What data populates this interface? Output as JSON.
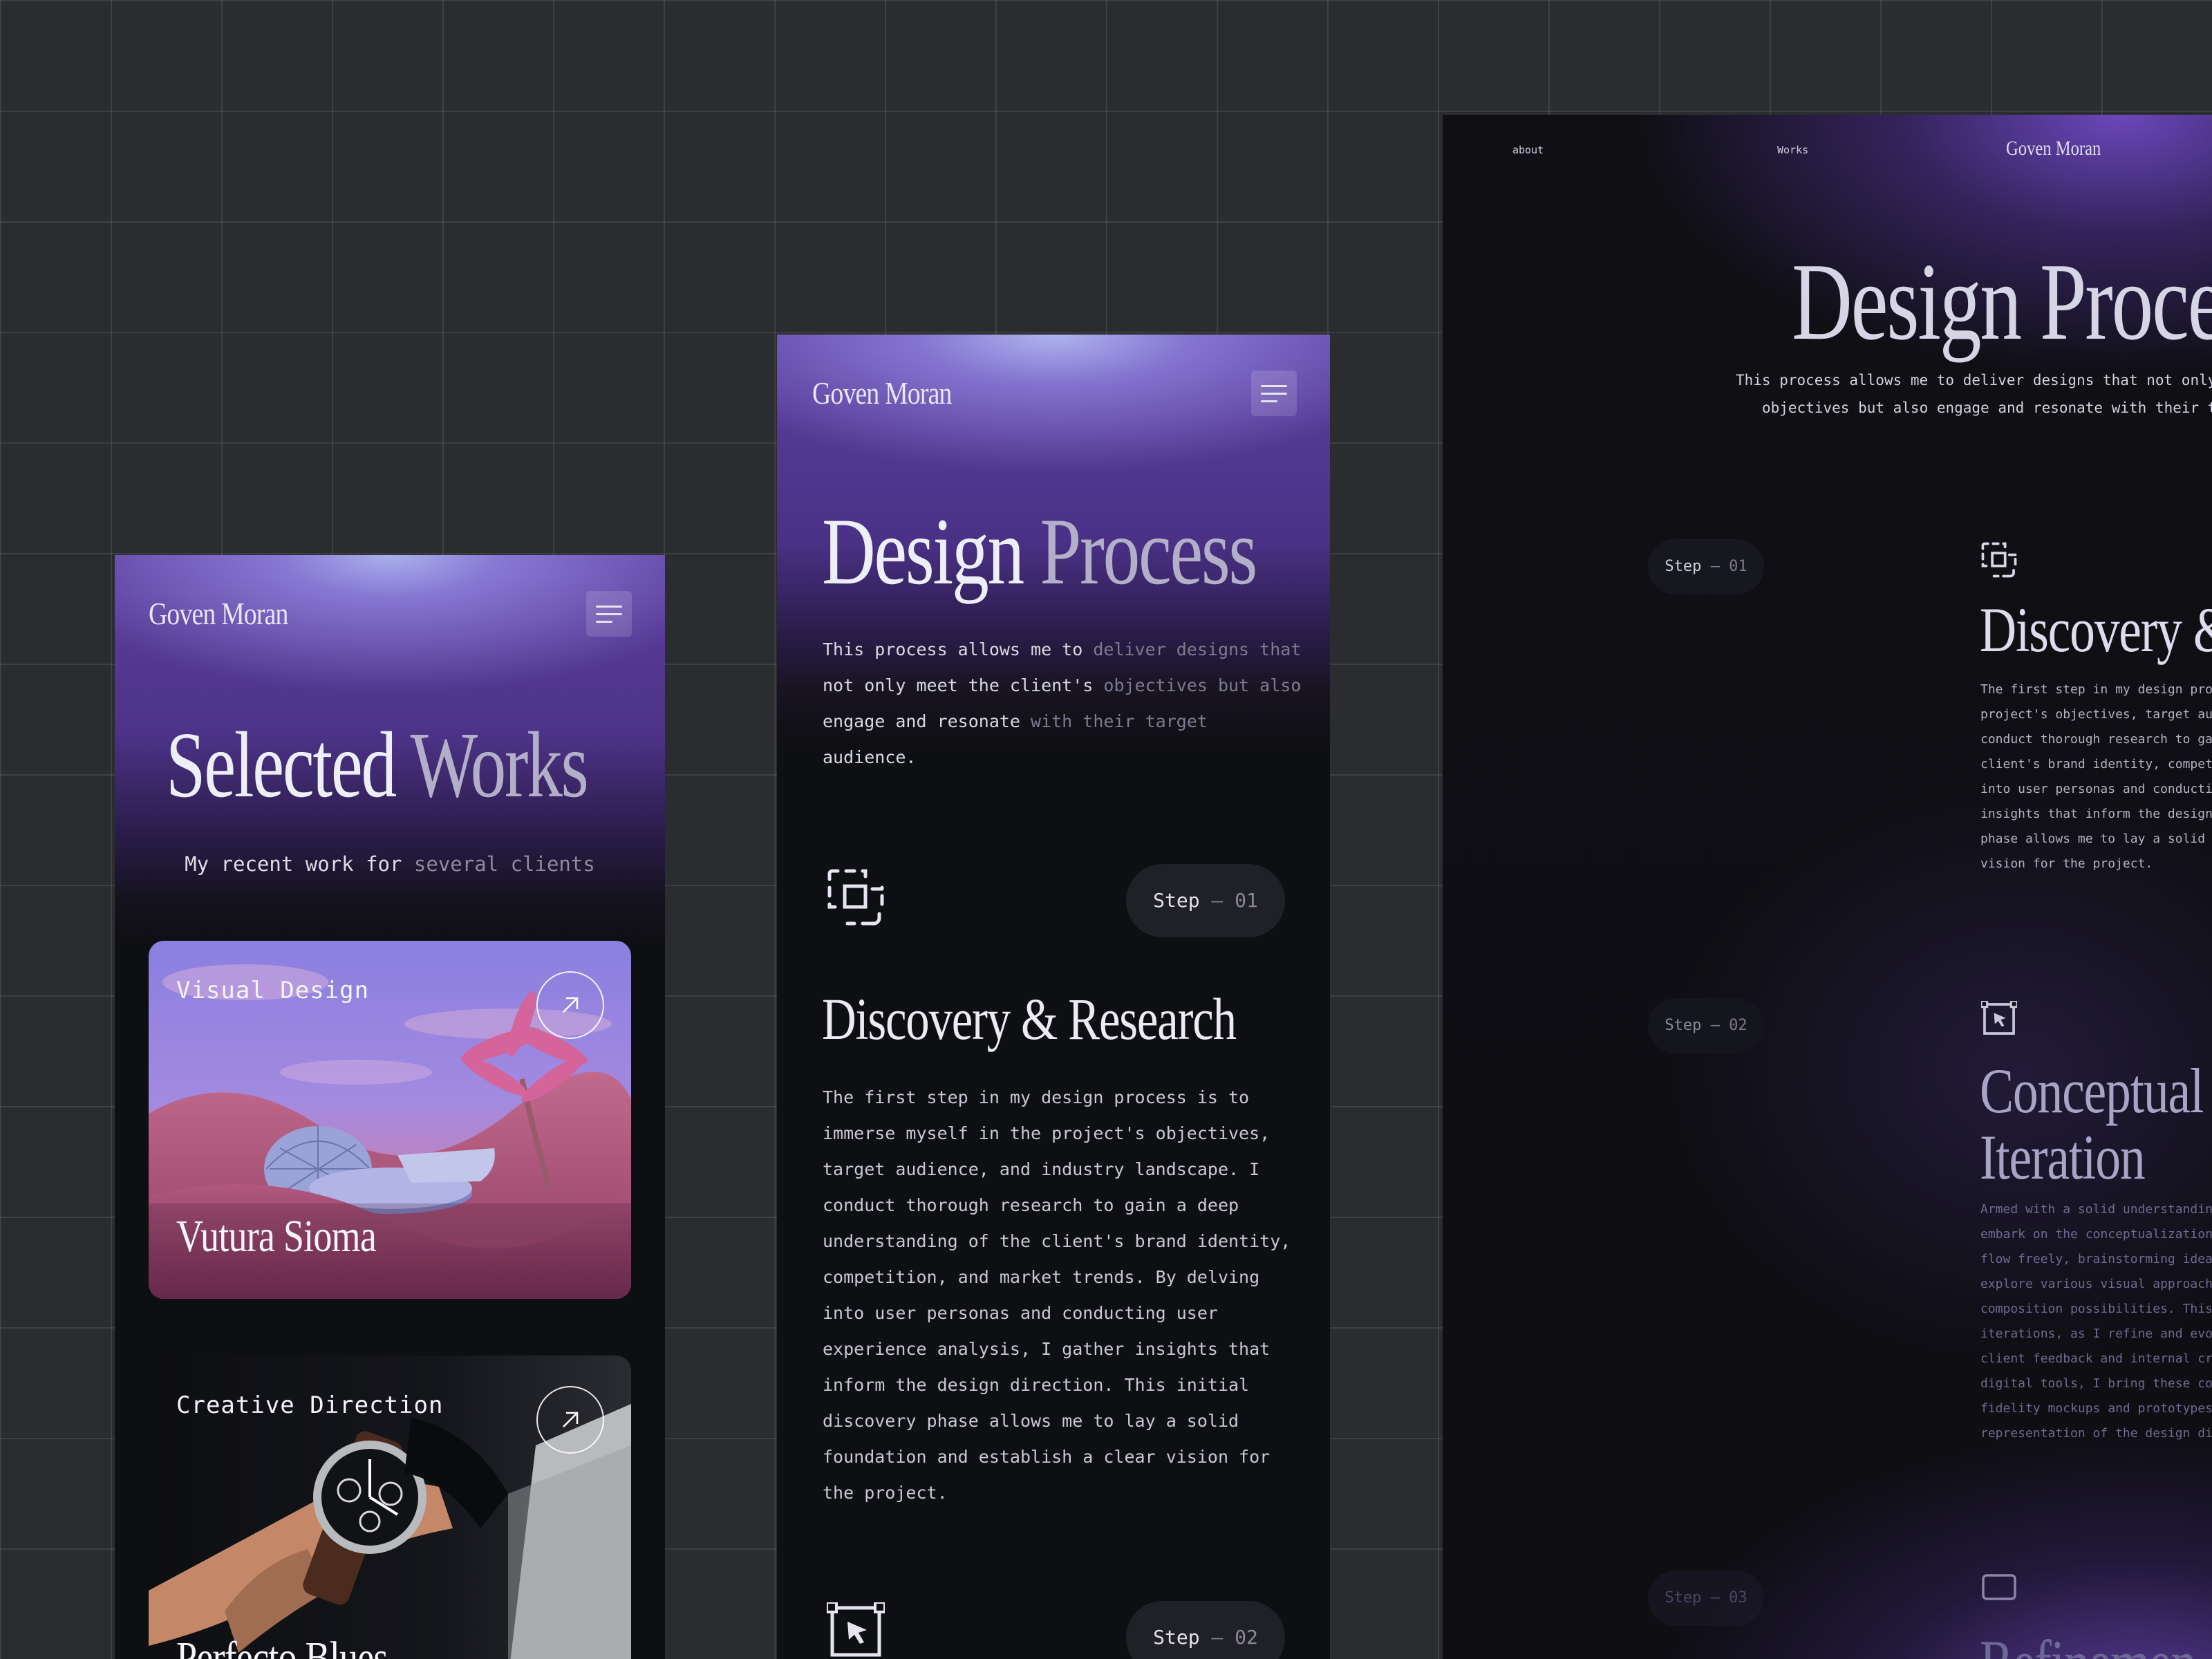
{
  "works_page": {
    "brand": "Goven Moran",
    "title_word1": "Selected",
    "title_word2": "Works",
    "subtitle_a": "My recent work for ",
    "subtitle_b": "several clients",
    "cards": [
      {
        "tag": "Visual Design",
        "title": "Vutura Sioma"
      },
      {
        "tag": "Creative Direction",
        "title": "Perfecto Blues"
      }
    ]
  },
  "process_page": {
    "brand": "Goven Moran",
    "title_word1": "Design",
    "title_word2": "Process",
    "intro_lines": [
      {
        "a": "This process allows me to ",
        "b": "deliver designs that"
      },
      {
        "a": "not only meet the client's ",
        "b": "objectives but also"
      },
      {
        "a": "engage and resonate ",
        "b": "with their target"
      },
      {
        "a": "audience.",
        "b": ""
      }
    ],
    "steps": [
      {
        "label": "Step",
        "dash": "–",
        "num": "01",
        "title": "Discovery & Research",
        "body_lines": [
          "The first step in my design process is to",
          "immerse myself in the project's objectives,",
          "target audience, and industry landscape. I",
          "conduct thorough research to gain a deep",
          "understanding of the client's brand identity,",
          "competition, and market trends. By delving",
          "into user personas and conducting user",
          "experience analysis, I gather insights that",
          "inform the design direction. This initial",
          "discovery phase allows me to lay a solid",
          "foundation and establish a clear vision for",
          "the project."
        ]
      },
      {
        "label": "Step",
        "dash": "–",
        "num": "02"
      }
    ]
  },
  "desktop_page": {
    "nav": {
      "about": "about",
      "works": "Works",
      "brand": "Goven Moran"
    },
    "title": "Design Proce",
    "intro_lines": [
      {
        "a": "This process allows me to deliver designs that not only m"
      },
      {
        "a": "objectives but also engage and resonate with their tar"
      }
    ],
    "steps": [
      {
        "label": "Step",
        "dash": "–",
        "num": "01",
        "title": "Discovery &",
        "body_lines": [
          "The first step in my design process",
          "project's objectives, target audien",
          "conduct thorough research to gain a",
          "client's brand identity, competitio",
          "into user personas and conducting u",
          "insights that inform the design dir",
          "phase allows me to lay a solid foun",
          "vision for the project."
        ]
      },
      {
        "label": "Step",
        "dash": "–",
        "num": "02",
        "title_line1": "Conceptual",
        "title_line2": "Iteration",
        "body_lines": [
          "Armed with a solid understanding of",
          "embark on the conceptualization sta",
          "flow freely, brainstorming ideas, a",
          "explore various visual approaches,",
          "composition possibilities. This pha",
          "iterations, as I refine and evolve",
          "client feedback and internal critiq",
          "digital tools, I bring these concep",
          "fidelity mockups and prototypes tha",
          "representation of the design direct"
        ]
      },
      {
        "label": "Step",
        "dash": "–",
        "num": "03",
        "title": "Refinemen"
      }
    ]
  },
  "colors": {
    "canvas": "#2b2c30",
    "frame_bg": "#0e0f13",
    "accent_purple": "#5c3e9e",
    "text_primary": "#eeeef6",
    "text_dim": "#7e7b8e"
  }
}
